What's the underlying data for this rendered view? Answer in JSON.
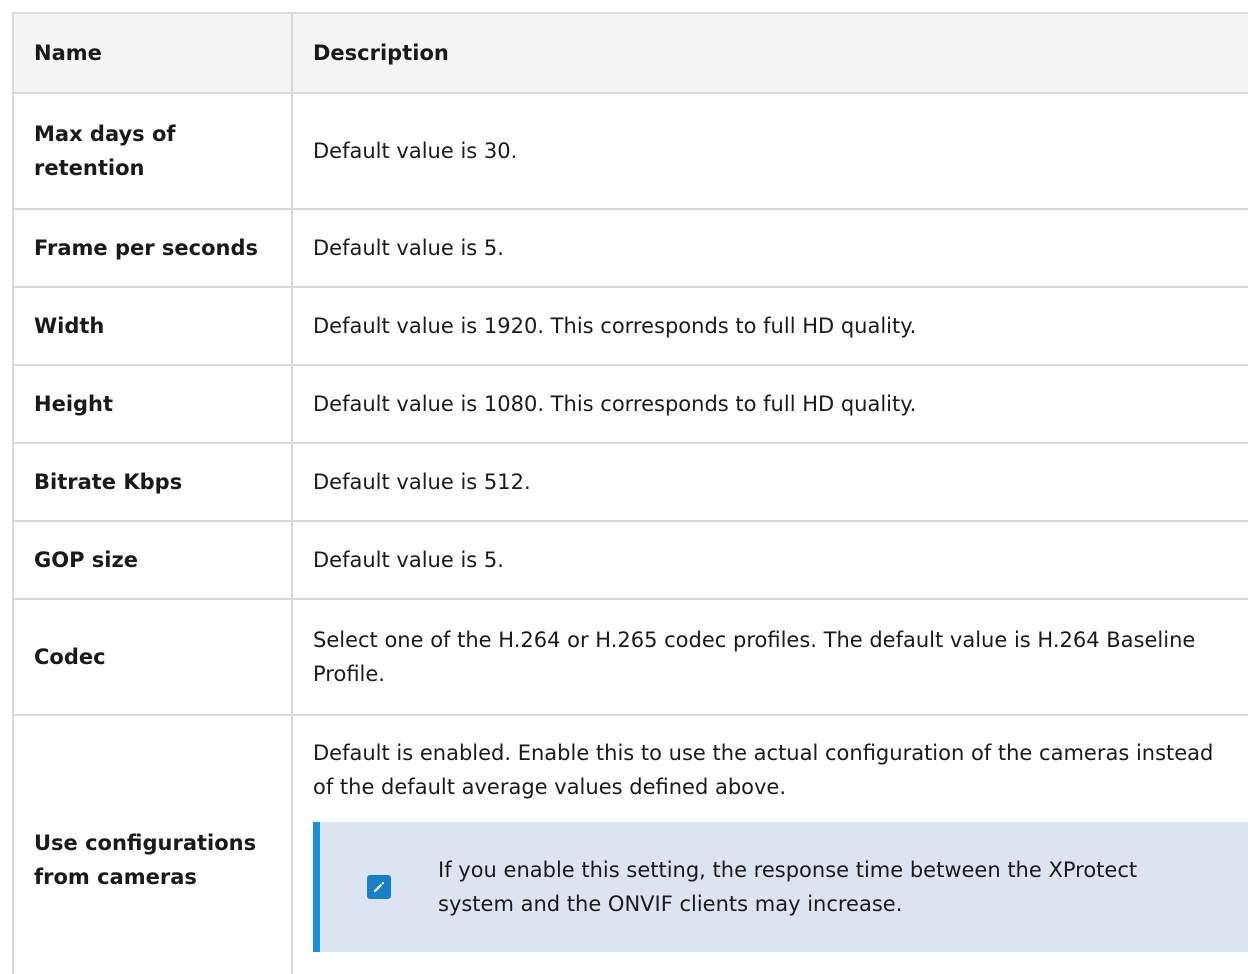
{
  "table": {
    "headers": {
      "name": "Name",
      "description": "Description"
    },
    "rows": [
      {
        "name": "Max days of retention",
        "description": "Default value is 30."
      },
      {
        "name": "Frame per seconds",
        "description": "Default value is 5."
      },
      {
        "name": "Width",
        "description": "Default value is 1920. This corresponds to full HD quality."
      },
      {
        "name": "Height",
        "description": "Default value is 1080. This corresponds to full HD quality."
      },
      {
        "name": "Bitrate Kbps",
        "description": "Default value is 512."
      },
      {
        "name": "GOP size",
        "description": "Default value is 5."
      },
      {
        "name": "Codec",
        "description": "Select one of the H.264 or H.265 codec profiles. The default value is H.264 Baseline Profile."
      },
      {
        "name": "Use configurations from cameras",
        "description": "Default is enabled. Enable this to use the actual configuration of the cameras instead of the default average values defined above.",
        "note": {
          "icon": "pencil-edit-icon",
          "text": "If you enable this setting, the response time between the XProtect system and the ONVIF clients may increase."
        }
      }
    ]
  },
  "colors": {
    "header_bg": "#f5f5f5",
    "border": "#d9d9d9",
    "note_bg": "#dce4f2",
    "note_accent": "#1b8ed8"
  }
}
